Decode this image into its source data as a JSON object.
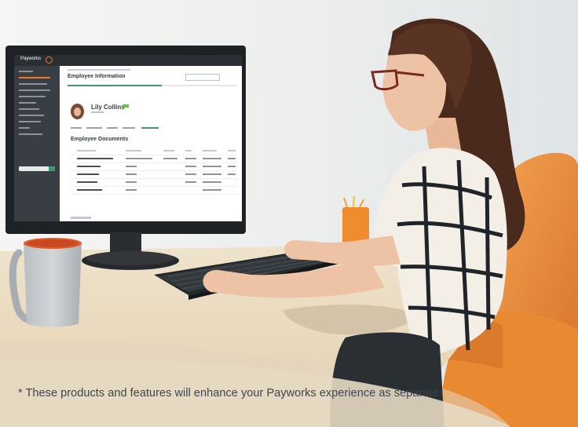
{
  "screen": {
    "app_name": "Payworks",
    "page_title": "Employee Information",
    "employee_name": "Lily Collins",
    "section_title": "Employee Documents"
  },
  "disclaimer": "* These products and features will enhance your Payworks experience as separate",
  "colors": {
    "brand_orange": "#f07a22",
    "accent_green": "#3a9a6e",
    "sidebar": "#383e43",
    "chair_orange": "#e98a33",
    "desk": "#e9d9bf",
    "disclaimer_text": "#3d454d"
  }
}
